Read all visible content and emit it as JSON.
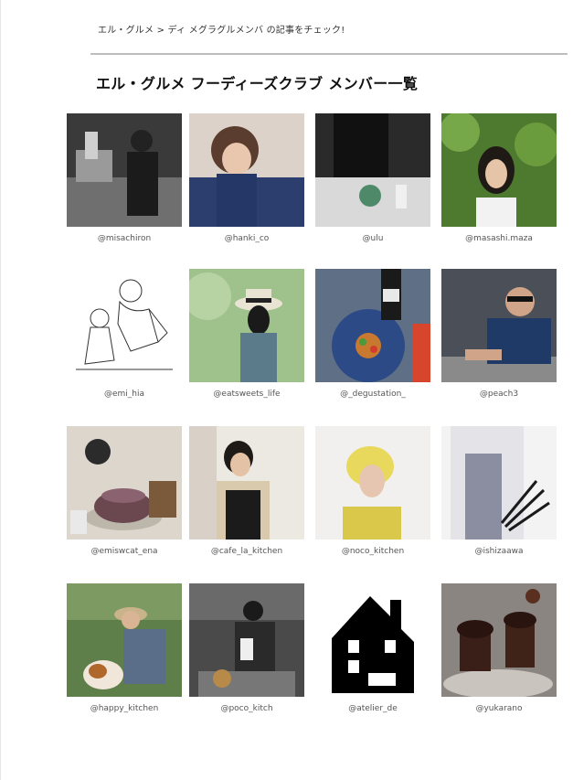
{
  "breadcrumb": "エル・グルメ > ディ メグラグルメンバ の記事をチェック!",
  "page_title": "エル・グルメ フーディーズクラブ メンバー一覧",
  "members": [
    {
      "handle": "@misachiron"
    },
    {
      "handle": "@hanki_co"
    },
    {
      "handle": "@ulu"
    },
    {
      "handle": "@masashi.maza"
    },
    {
      "handle": "@emi_hia"
    },
    {
      "handle": "@eatsweets_life"
    },
    {
      "handle": "@_degustation_"
    },
    {
      "handle": "@peach3"
    },
    {
      "handle": "@emiswcat_ena"
    },
    {
      "handle": "@cafe_la_kitchen"
    },
    {
      "handle": "@noco_kitchen"
    },
    {
      "handle": "@ishizaawa"
    },
    {
      "handle": "@happy_kitchen"
    },
    {
      "handle": "@poco_kitch"
    },
    {
      "handle": "@atelier_de"
    },
    {
      "handle": "@yukarano"
    }
  ]
}
